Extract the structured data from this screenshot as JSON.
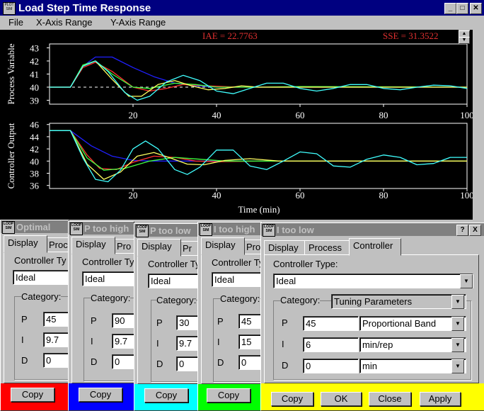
{
  "main": {
    "title": "Load Step Time Response",
    "app_icon_text": "PLOT SIM",
    "menu": [
      "File",
      "X-Axis Range",
      "Y-Axis Range"
    ],
    "iae": "IAE = 22.7763",
    "sse": "SSE = 31.3522",
    "xlabel": "Time (min)"
  },
  "chart_data": [
    {
      "type": "line",
      "ylabel": "Process Variable",
      "x_ticks": [
        "20",
        "40",
        "60",
        "80",
        "100"
      ],
      "y_ticks": [
        "43",
        "42",
        "41",
        "40",
        "39"
      ],
      "xlim": [
        0,
        100
      ],
      "ylim": [
        38.7,
        43.3
      ],
      "setpoint": 40,
      "series": [
        {
          "color": "#2020ff",
          "values": [
            [
              0,
              40
            ],
            [
              5,
              40
            ],
            [
              8,
              41.6
            ],
            [
              11,
              42.3
            ],
            [
              15,
              42.3
            ],
            [
              20,
              41.5
            ],
            [
              25,
              40.8
            ],
            [
              30,
              40.3
            ],
            [
              35,
              40.1
            ],
            [
              40,
              40.0
            ],
            [
              50,
              40.0
            ],
            [
              100,
              40.0
            ]
          ]
        },
        {
          "color": "#ff3030",
          "values": [
            [
              0,
              40
            ],
            [
              5,
              40
            ],
            [
              8,
              41.5
            ],
            [
              11,
              41.9
            ],
            [
              15,
              41.2
            ],
            [
              20,
              40.0
            ],
            [
              24,
              39.7
            ],
            [
              28,
              39.9
            ],
            [
              32,
              40.2
            ],
            [
              38,
              40.1
            ],
            [
              45,
              40.0
            ],
            [
              100,
              40.0
            ]
          ]
        },
        {
          "color": "#40ff40",
          "values": [
            [
              0,
              40
            ],
            [
              5,
              40
            ],
            [
              8,
              41.7
            ],
            [
              11,
              42.0
            ],
            [
              15,
              41.0
            ],
            [
              20,
              40.0
            ],
            [
              24,
              39.9
            ],
            [
              30,
              40.3
            ],
            [
              35,
              40.2
            ],
            [
              40,
              40.0
            ],
            [
              50,
              40.0
            ],
            [
              60,
              40.05
            ],
            [
              100,
              40.0
            ]
          ]
        },
        {
          "color": "#ffff60",
          "values": [
            [
              0,
              40
            ],
            [
              5,
              40
            ],
            [
              8,
              41.6
            ],
            [
              11,
              42.0
            ],
            [
              15,
              40.6
            ],
            [
              19,
              39.3
            ],
            [
              22,
              39.3
            ],
            [
              26,
              40.2
            ],
            [
              30,
              40.5
            ],
            [
              34,
              40.1
            ],
            [
              38,
              39.8
            ],
            [
              42,
              39.9
            ],
            [
              46,
              40.1
            ],
            [
              50,
              40.0
            ],
            [
              100,
              40.0
            ]
          ]
        },
        {
          "color": "#40ffff",
          "values": [
            [
              0,
              40
            ],
            [
              5,
              40
            ],
            [
              8,
              41.6
            ],
            [
              11,
              42.0
            ],
            [
              14,
              41.2
            ],
            [
              18,
              39.6
            ],
            [
              21,
              39.0
            ],
            [
              24,
              39.3
            ],
            [
              28,
              40.4
            ],
            [
              32,
              40.9
            ],
            [
              36,
              40.5
            ],
            [
              40,
              39.7
            ],
            [
              44,
              39.5
            ],
            [
              48,
              39.9
            ],
            [
              52,
              40.3
            ],
            [
              56,
              40.3
            ],
            [
              60,
              39.9
            ],
            [
              64,
              39.7
            ],
            [
              68,
              39.9
            ],
            [
              72,
              40.2
            ],
            [
              76,
              40.2
            ],
            [
              80,
              39.9
            ],
            [
              84,
              39.8
            ],
            [
              88,
              40.0
            ],
            [
              92,
              40.15
            ],
            [
              96,
              40.1
            ],
            [
              100,
              39.9
            ]
          ]
        }
      ]
    },
    {
      "type": "line",
      "ylabel": "Controller Output",
      "x_ticks": [
        "20",
        "40",
        "60",
        "80",
        "100"
      ],
      "y_ticks": [
        "46",
        "44",
        "42",
        "40",
        "38",
        "36"
      ],
      "xlim": [
        0,
        100
      ],
      "ylim": [
        35.5,
        46.2
      ],
      "series": [
        {
          "color": "#2020ff",
          "values": [
            [
              0,
              45
            ],
            [
              5,
              45
            ],
            [
              10,
              42.5
            ],
            [
              15,
              40.8
            ],
            [
              20,
              40.1
            ],
            [
              25,
              40.0
            ],
            [
              100,
              40.0
            ]
          ]
        },
        {
          "color": "#ff3030",
          "values": [
            [
              0,
              45
            ],
            [
              5,
              45
            ],
            [
              9,
              41.0
            ],
            [
              12,
              38.8
            ],
            [
              16,
              38.6
            ],
            [
              20,
              39.8
            ],
            [
              25,
              40.8
            ],
            [
              30,
              40.6
            ],
            [
              35,
              40.0
            ],
            [
              40,
              39.9
            ],
            [
              50,
              40.0
            ],
            [
              100,
              40.0
            ]
          ]
        },
        {
          "color": "#40ff40",
          "values": [
            [
              0,
              45
            ],
            [
              5,
              45
            ],
            [
              9,
              40.5
            ],
            [
              13,
              38.5
            ],
            [
              18,
              38.8
            ],
            [
              24,
              40.0
            ],
            [
              30,
              40.6
            ],
            [
              36,
              40.3
            ],
            [
              42,
              40.0
            ],
            [
              50,
              40.0
            ],
            [
              100,
              40.0
            ]
          ]
        },
        {
          "color": "#ffff60",
          "values": [
            [
              0,
              45
            ],
            [
              5,
              45
            ],
            [
              9,
              39.5
            ],
            [
              13,
              37.0
            ],
            [
              17,
              38.2
            ],
            [
              21,
              40.8
            ],
            [
              25,
              41.4
            ],
            [
              29,
              40.5
            ],
            [
              33,
              39.5
            ],
            [
              37,
              39.4
            ],
            [
              42,
              40.1
            ],
            [
              48,
              40.4
            ],
            [
              55,
              40.0
            ],
            [
              100,
              40.0
            ]
          ]
        },
        {
          "color": "#40ffff",
          "values": [
            [
              0,
              45
            ],
            [
              5,
              45
            ],
            [
              8,
              40.5
            ],
            [
              11,
              37.0
            ],
            [
              14,
              36.6
            ],
            [
              17,
              38.5
            ],
            [
              20,
              42.0
            ],
            [
              23,
              43.3
            ],
            [
              26,
              42.0
            ],
            [
              30,
              38.6
            ],
            [
              33,
              37.8
            ],
            [
              36,
              39.0
            ],
            [
              40,
              41.8
            ],
            [
              44,
              41.8
            ],
            [
              48,
              39.2
            ],
            [
              52,
              38.6
            ],
            [
              56,
              40.0
            ],
            [
              60,
              41.5
            ],
            [
              64,
              41.2
            ],
            [
              68,
              39.2
            ],
            [
              72,
              39.0
            ],
            [
              76,
              40.3
            ],
            [
              80,
              41.0
            ],
            [
              84,
              40.6
            ],
            [
              88,
              39.4
            ],
            [
              92,
              39.6
            ],
            [
              96,
              40.6
            ],
            [
              100,
              40.6
            ]
          ]
        }
      ]
    }
  ],
  "dialogs": [
    {
      "title": "Optimal",
      "tabs": [
        "Display",
        "Proc"
      ],
      "type_label": "Controller Ty",
      "type_value": "Ideal",
      "category_label": "Category:",
      "p_label": "P",
      "p": "45",
      "i_label": "I",
      "i": "9.7",
      "d_label": "D",
      "d": "0",
      "copy": "Copy",
      "color": "#ff0000"
    },
    {
      "title": "P too high",
      "tabs": [
        "Display",
        "Pro"
      ],
      "type_label": "Controller Ty",
      "type_value": "Ideal",
      "category_label": "Category:",
      "p_label": "P",
      "p": "90",
      "i_label": "I",
      "i": "9.7",
      "d_label": "D",
      "d": "0",
      "copy": "Copy",
      "color": "#0000ff"
    },
    {
      "title": "P too low",
      "tabs": [
        "Display",
        "Pr"
      ],
      "type_label": "Controller Ty",
      "type_value": "Ideal",
      "category_label": "Category:",
      "p_label": "P",
      "p": "30",
      "i_label": "I",
      "i": "9.7",
      "d_label": "D",
      "d": "0",
      "copy": "Copy",
      "color": "#00ffff"
    },
    {
      "title": "I too high",
      "tabs": [
        "Display",
        "Pro"
      ],
      "type_label": "Controller Ty",
      "type_value": "Ideal",
      "category_label": "Category:",
      "p_label": "P",
      "p": "45",
      "i_label": "I",
      "i": "15",
      "d_label": "D",
      "d": "0",
      "copy": "Copy",
      "color": "#00ff00"
    },
    {
      "title": "I too low",
      "tabs": [
        "Display",
        "Process",
        "Controller"
      ],
      "type_label": "Controller Type:",
      "type_value": "Ideal",
      "category_label": "Category:",
      "category_value": "Tuning Parameters",
      "p_label": "P",
      "p": "45",
      "p_unit": "Proportional Band",
      "i_label": "I",
      "i": "6",
      "i_unit": "min/rep",
      "d_label": "D",
      "d": "0",
      "d_unit": "min",
      "copy": "Copy",
      "ok": "OK",
      "close": "Close",
      "apply": "Apply",
      "help": "?",
      "x": "X",
      "color": "#ffff00"
    }
  ],
  "dialog_icon_text": "LOOP SIM"
}
